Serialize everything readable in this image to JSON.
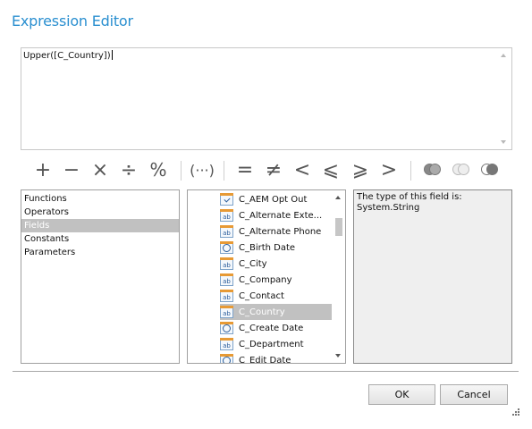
{
  "dialog": {
    "title": "Expression Editor"
  },
  "editor": {
    "value": "Upper([C_Country])"
  },
  "toolbar": {
    "plus": "+",
    "minus": "−",
    "multiply": "×",
    "divide": "÷",
    "percent": "%",
    "parentheses": "(···)",
    "equal": "=",
    "not_equal": "≠",
    "less": "<",
    "less_equal": "⩽",
    "greater_equal": "⩾",
    "greater": ">"
  },
  "categories": [
    "Functions",
    "Operators",
    "Fields",
    "Constants",
    "Parameters"
  ],
  "fields": [
    {
      "label": "C_AEM Opt Out",
      "icon": "check"
    },
    {
      "label": "C_Alternate Exte...",
      "icon": "ab"
    },
    {
      "label": "C_Alternate Phone",
      "icon": "ab"
    },
    {
      "label": "C_Birth Date",
      "icon": "clock"
    },
    {
      "label": "C_City",
      "icon": "ab"
    },
    {
      "label": "C_Company",
      "icon": "ab"
    },
    {
      "label": "C_Contact",
      "icon": "ab"
    },
    {
      "label": "C_Country",
      "icon": "ab"
    },
    {
      "label": "C_Create Date",
      "icon": "clock"
    },
    {
      "label": "C_Department",
      "icon": "ab"
    },
    {
      "label": "C_Edit Date",
      "icon": "clock"
    }
  ],
  "field_icon_text": "ab",
  "description": {
    "line1": "The type of this field is:",
    "line2": "System.String"
  },
  "buttons": {
    "ok": "OK",
    "cancel": "Cancel"
  }
}
